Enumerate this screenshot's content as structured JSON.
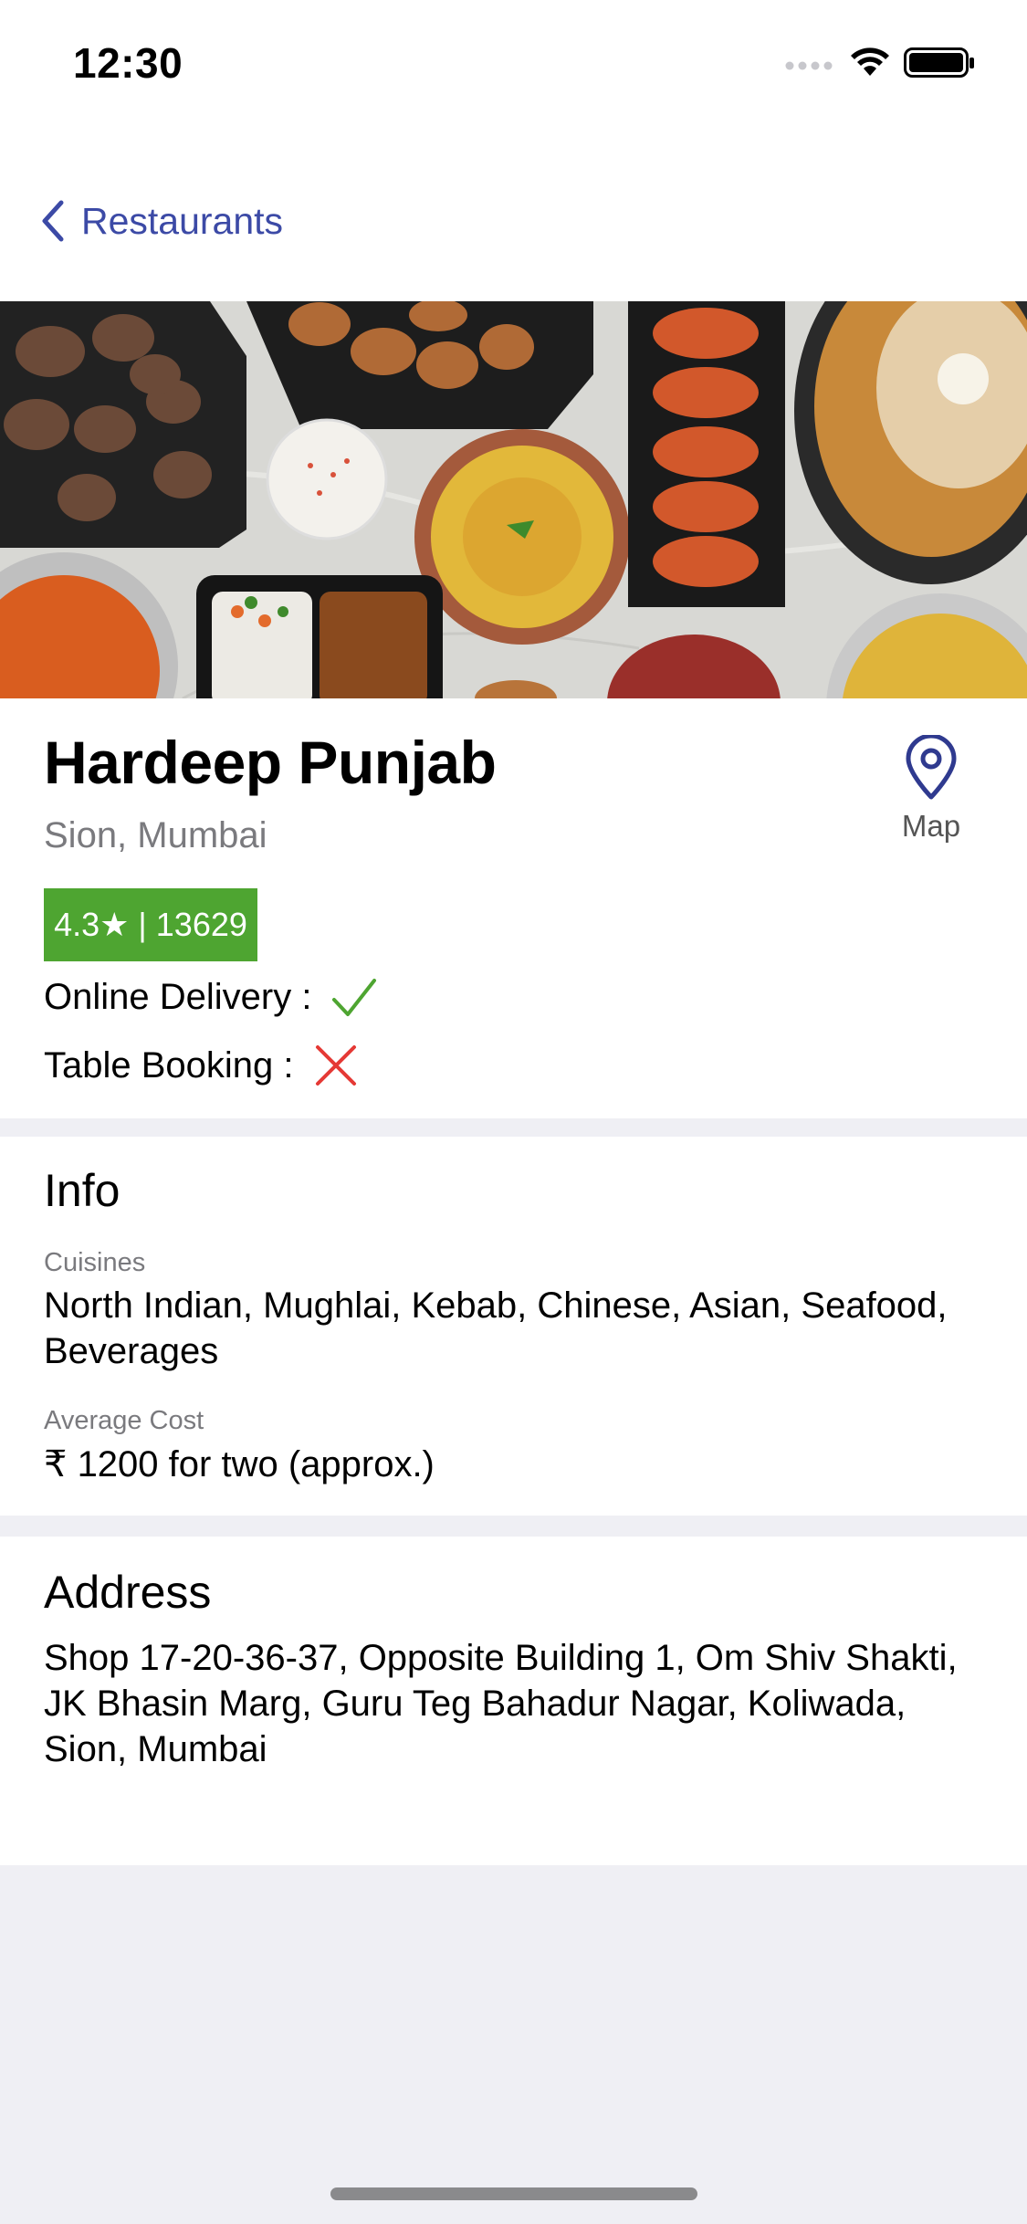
{
  "status_bar": {
    "time": "12:30",
    "icons": [
      "cellular-dots-icon",
      "wifi-icon",
      "battery-icon"
    ]
  },
  "nav": {
    "back_label": "Restaurants",
    "back_icon": "chevron-left-icon",
    "accent_color": "#3c4aa6"
  },
  "hero": {
    "image": "food-spread-photo"
  },
  "restaurant": {
    "name": "Hardeep Punjab",
    "location": "Sion, Mumbai",
    "rating_text": "4.3★ | 13629",
    "rating_color": "#4ea531",
    "map_label": "Map",
    "map_icon": "map-pin-icon",
    "features": [
      {
        "label": "Online Delivery :",
        "available": true,
        "icon": "checkmark-icon",
        "color": "#4ea531"
      },
      {
        "label": "Table Booking :",
        "available": false,
        "icon": "cross-icon",
        "color": "#e53935"
      }
    ]
  },
  "info": {
    "title": "Info",
    "cuisines_label": "Cuisines",
    "cuisines_value": "North Indian, Mughlai, Kebab, Chinese, Asian, Seafood, Beverages",
    "avg_cost_label": "Average Cost",
    "avg_cost_value": "₹ 1200 for two (approx.)"
  },
  "address": {
    "title": "Address",
    "value": "Shop 17-20-36-37, Opposite Building 1, Om Shiv Shakti, JK Bhasin Marg, Guru Teg Bahadur Nagar, Koliwada, Sion, Mumbai"
  }
}
